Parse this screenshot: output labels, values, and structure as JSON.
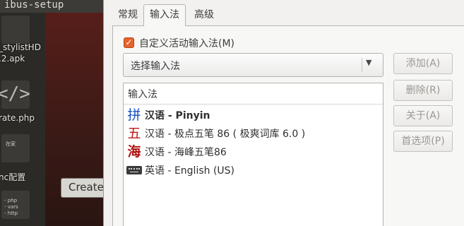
{
  "background": {
    "window_title": "ibus-setup",
    "files": [
      {
        "label": "_stylistHD"
      },
      {
        "label": ".2.apk"
      },
      {
        "label": "rate.php"
      },
      {
        "label": "nc配置"
      }
    ],
    "icon_glyph": "</>",
    "small_icon_text": "在家",
    "small_icon_lines": [
      "- php",
      "- vars",
      "- http"
    ],
    "create_button_label": "Create"
  },
  "dialog": {
    "tabs": [
      {
        "label": "常规",
        "active": false
      },
      {
        "label": "输入法",
        "active": true
      },
      {
        "label": "高级",
        "active": false
      }
    ],
    "customize_checkbox": {
      "label": "自定义活动输入法(M)",
      "checked": true,
      "mark": "✓"
    },
    "combo": {
      "value": "选择输入法",
      "arrow": "▼"
    },
    "list": {
      "header": "输入法",
      "items": [
        {
          "icon": "拼",
          "icon_name": "pinyin-icon",
          "icon_color": "#1a4fc8",
          "label": "汉语 - Pinyin",
          "bold": true
        },
        {
          "icon": "五",
          "icon_name": "wubi-jidian-icon",
          "icon_color": "#c01818",
          "label": "汉语 - 极点五笔 86 ( 极爽词库 6.0 )",
          "bold": false
        },
        {
          "icon": "海",
          "icon_name": "haifeng-wubi-icon",
          "icon_color": "#b01010",
          "label": "汉语 - 海峰五笔86",
          "bold": false
        },
        {
          "icon": "",
          "icon_name": "keyboard-icon",
          "icon_color": "#3a3a3a",
          "label": "英语 - English (US)",
          "bold": false
        }
      ]
    },
    "buttons": {
      "add": "添加(A)",
      "remove": "删除(R)",
      "about": "关于(A)",
      "preferences": "首选项(P)"
    }
  }
}
